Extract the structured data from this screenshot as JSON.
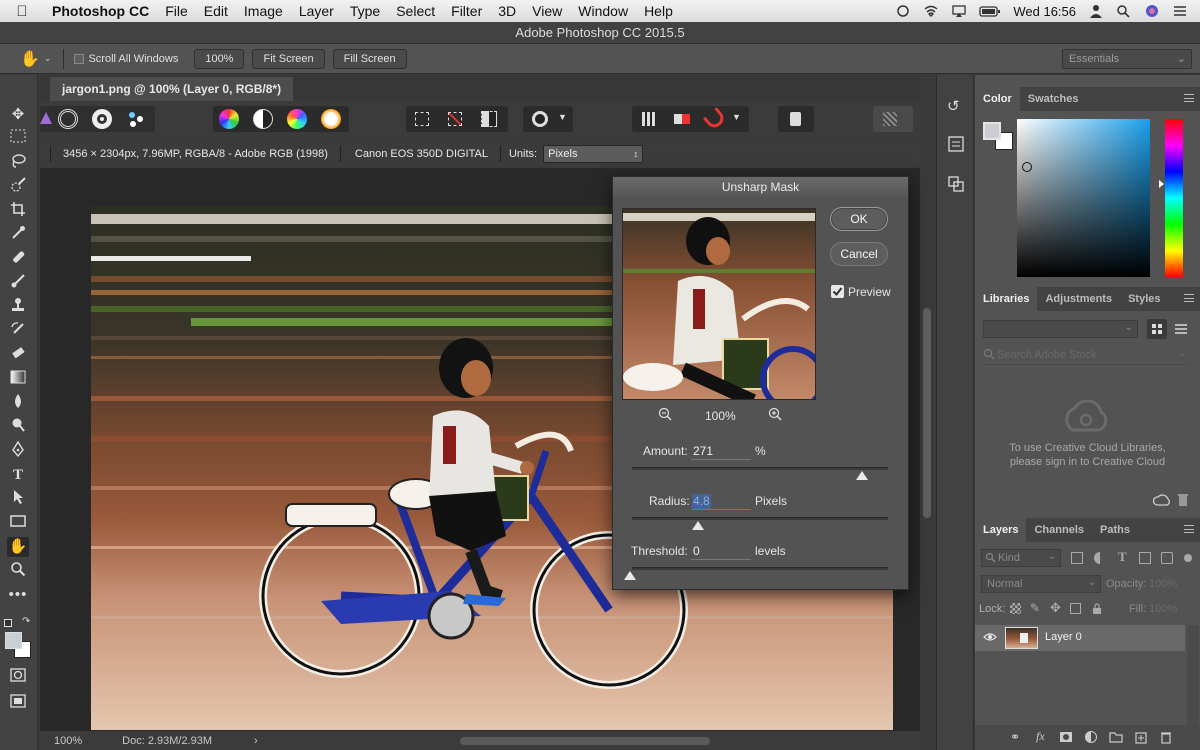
{
  "menubar": {
    "app_name": "Photoshop CC",
    "items": [
      "File",
      "Edit",
      "Image",
      "Layer",
      "Type",
      "Select",
      "Filter",
      "3D",
      "View",
      "Window",
      "Help"
    ],
    "clock": "Wed 16:56"
  },
  "window": {
    "title": "Adobe Photoshop CC 2015.5"
  },
  "options_bar": {
    "scroll_all_windows": "Scroll All Windows",
    "zoom_100": "100%",
    "fit_screen": "Fit Screen",
    "fill_screen": "Fill Screen",
    "workspace": "Essentials"
  },
  "document": {
    "tab_title": "jargon1.png @ 100% (Layer 0, RGB/8*)",
    "info_dimensions": "3456 × 2304px, 7.96MP, RGBA/8 - Adobe RGB (1998)",
    "camera": "Canon EOS 350D DIGITAL",
    "units_label": "Units:",
    "units_value": "Pixels"
  },
  "status": {
    "zoom": "100%",
    "doc_size": "Doc: 2.93M/2.93M"
  },
  "dialog": {
    "title": "Unsharp Mask",
    "ok": "OK",
    "cancel": "Cancel",
    "preview_label": "Preview",
    "preview_checked": true,
    "preview_zoom": "100%",
    "amount_label": "Amount:",
    "amount_value": "271",
    "amount_unit": "%",
    "radius_label": "Radius:",
    "radius_value": "4.8",
    "radius_unit": "Pixels",
    "threshold_label": "Threshold:",
    "threshold_value": "0",
    "threshold_unit": "levels"
  },
  "right_panels": {
    "color_tabs": [
      "Color",
      "Swatches"
    ],
    "library_tabs": [
      "Libraries",
      "Adjustments",
      "Styles"
    ],
    "library_search_placeholder": "Search Adobe Stock",
    "library_message_1": "To use Creative Cloud Libraries,",
    "library_message_2": "please sign in to Creative Cloud",
    "layers_tabs": [
      "Layers",
      "Channels",
      "Paths"
    ],
    "kind_label": "Kind",
    "blend_mode": "Normal",
    "opacity_label": "Opacity:",
    "opacity_value": "100%",
    "lock_label": "Lock:",
    "fill_label": "Fill:",
    "fill_value": "100%",
    "layer_name": "Layer 0"
  }
}
